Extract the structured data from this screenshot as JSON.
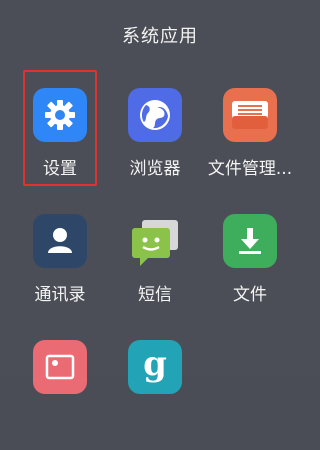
{
  "panel": {
    "title": "系统应用"
  },
  "apps": [
    {
      "label": "设置",
      "icon": "gear-icon",
      "color": "#2f86f6",
      "selected": true
    },
    {
      "label": "浏览器",
      "icon": "globe-icon",
      "color": "#4f6be6"
    },
    {
      "label": "文件管理...",
      "icon": "folder-icon",
      "color": "#e8704f"
    },
    {
      "label": "通讯录",
      "icon": "contact-icon",
      "color": "#2e4667"
    },
    {
      "label": "短信",
      "icon": "message-icon",
      "color": "#8bc34a"
    },
    {
      "label": "文件",
      "icon": "download-icon",
      "color": "#3fae5c"
    },
    {
      "label": "",
      "icon": "gallery-icon",
      "color": "#ea6b73"
    },
    {
      "label": "",
      "icon": "g-icon",
      "color": "#22a3b6"
    }
  ]
}
